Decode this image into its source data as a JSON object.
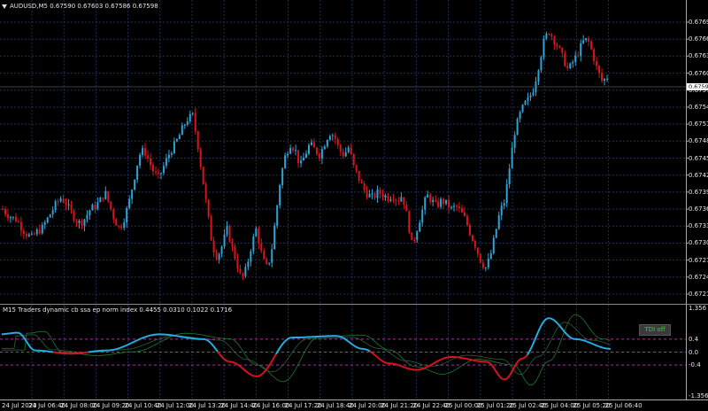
{
  "main_title": "AUDUSD,M5  0.67590 0.67603 0.67586 0.67598",
  "indicator_title": "M15  Traders dynamic cb ssa ep norm index 0.4455 0.0310 0.1022 0.1716",
  "tdi_badge": "TDI off",
  "current_price": "0.67598",
  "colors": {
    "bull": "#2fa3d6",
    "bear": "#d8141e",
    "grid": "#1c2f5a",
    "fast_line": "#27aee6",
    "slow_line": "#1f7a2f",
    "level_line": "#9a3a9a"
  },
  "price_axis": [
    "0.67695",
    "0.67665",
    "0.67635",
    "0.67605",
    "0.67575",
    "0.67545",
    "0.67515",
    "0.67485",
    "0.67455",
    "0.67425",
    "0.67395",
    "0.67365",
    "0.67335",
    "0.67305",
    "0.67275",
    "0.67245",
    "0.67215"
  ],
  "indicator_axis": [
    "1.356",
    "0.4",
    "0.0",
    "-0.4",
    "-1.356"
  ],
  "time_axis": [
    "24 Jul 2023",
    "24 Jul 06:40",
    "24 Jul 08:00",
    "24 Jul 09:20",
    "24 Jul 10:40",
    "24 Jul 12:00",
    "24 Jul 13:20",
    "24 Jul 14:40",
    "24 Jul 16:00",
    "24 Jul 17:20",
    "24 Jul 18:40",
    "24 Jul 20:00",
    "24 Jul 21:20",
    "24 Jul 22:40",
    "25 Jul 00:00",
    "25 Jul 01:20",
    "25 Jul 02:40",
    "25 Jul 04:00",
    "25 Jul 05:20",
    "25 Jul 06:40"
  ],
  "close_path": [
    0.67365,
    0.67355,
    0.6735,
    0.67345,
    0.6733,
    0.6732,
    0.67315,
    0.67325,
    0.6733,
    0.67345,
    0.6736,
    0.67375,
    0.67385,
    0.67375,
    0.6736,
    0.67345,
    0.6734,
    0.6735,
    0.67365,
    0.6737,
    0.6738,
    0.67395,
    0.6737,
    0.67345,
    0.6733,
    0.6735,
    0.6738,
    0.6742,
    0.6746,
    0.6747,
    0.6745,
    0.6743,
    0.6742,
    0.6744,
    0.6746,
    0.67475,
    0.6749,
    0.6751,
    0.67525,
    0.6753,
    0.6748,
    0.6742,
    0.6736,
    0.673,
    0.6728,
    0.673,
    0.6733,
    0.673,
    0.6727,
    0.6724,
    0.6726,
    0.673,
    0.6733,
    0.6729,
    0.6726,
    0.6728,
    0.6735,
    0.6742,
    0.6746,
    0.6748,
    0.6747,
    0.6744,
    0.6746,
    0.6748,
    0.6747,
    0.6746,
    0.6748,
    0.675,
    0.67495,
    0.6747,
    0.6746,
    0.67475,
    0.6744,
    0.6742,
    0.674,
    0.6739,
    0.67385,
    0.67395,
    0.6739,
    0.67385,
    0.6739,
    0.6738,
    0.6739,
    0.6735,
    0.673,
    0.6733,
    0.6736,
    0.6739,
    0.6738,
    0.6737,
    0.6738,
    0.67375,
    0.67365,
    0.6737,
    0.6736,
    0.67345,
    0.6732,
    0.673,
    0.67275,
    0.6726,
    0.6728,
    0.6732,
    0.6736,
    0.6738,
    0.6744,
    0.675,
    0.6753,
    0.6755,
    0.6756,
    0.6758,
    0.6762,
    0.6766,
    0.6768,
    0.67665,
    0.6765,
    0.6763,
    0.6761,
    0.67625,
    0.6764,
    0.6766,
    0.67665,
    0.6764,
    0.6761,
    0.6759,
    0.67598
  ]
}
